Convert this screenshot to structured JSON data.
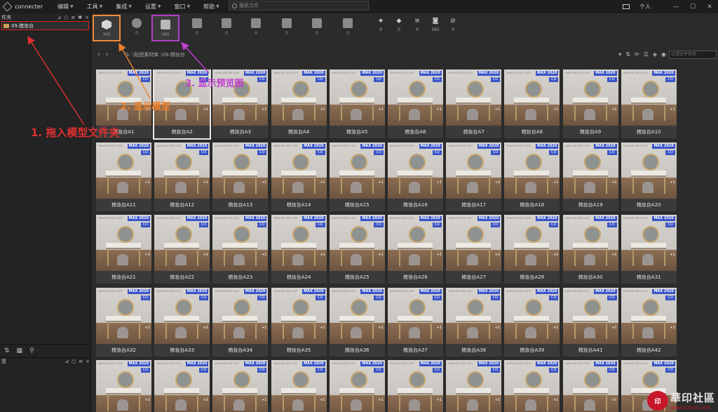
{
  "app": {
    "name": "connecter"
  },
  "menu": [
    {
      "label": "编辑"
    },
    {
      "label": "工具"
    },
    {
      "label": "集成"
    },
    {
      "label": "设置"
    },
    {
      "label": "窗口"
    },
    {
      "label": "帮助"
    }
  ],
  "search": {
    "placeholder": "搜索文件"
  },
  "user": {
    "label": "个人"
  },
  "sidebar": {
    "tree_header": "件夹",
    "tree_item": "09.梳妆台",
    "tag_header": "签"
  },
  "filters": {
    "tiles": [
      {
        "icon": "cube-icon",
        "count": "365"
      },
      {
        "icon": "sphere-icon",
        "count": "0"
      },
      {
        "icon": "image-icon",
        "count": "365"
      },
      {
        "icon": "video-icon",
        "count": "0"
      },
      {
        "icon": "audio-icon",
        "count": "0"
      },
      {
        "icon": "chart-icon",
        "count": "0"
      },
      {
        "icon": "font-icon",
        "count": "0"
      },
      {
        "icon": "code-icon",
        "count": "0"
      },
      {
        "icon": "document-icon",
        "count": "0"
      }
    ],
    "stats": [
      {
        "icon": "star-icon",
        "value": "0"
      },
      {
        "icon": "tag-icon",
        "value": "0"
      },
      {
        "icon": "list-icon",
        "value": "0"
      },
      {
        "icon": "camera-icon",
        "value": "365"
      },
      {
        "icon": "ban-icon",
        "value": "0"
      }
    ]
  },
  "breadcrumb": {
    "drive": "G:",
    "path1": "\\贴图素材库",
    "path2": "\\09.梳妆台"
  },
  "filter_input": {
    "placeholder": "过滤文件名称"
  },
  "card_meta": {
    "max": "MAX 2020",
    "co": "CO",
    "plus": "+1",
    "wm": "www.docaihi.com"
  },
  "items": [
    "梳妆台A1",
    "梳妆台A2",
    "梳妆台A3",
    "梳妆台A4",
    "梳妆台A5",
    "梳妆台A6",
    "梳妆台A7",
    "梳妆台A8",
    "梳妆台A9",
    "梳妆台A10",
    "梳妆台A11",
    "梳妆台A12",
    "梳妆台A13",
    "梳妆台A14",
    "梳妆台A15",
    "梳妆台A16",
    "梳妆台A17",
    "梳妆台A18",
    "梳妆台A19",
    "梳妆台A20",
    "梳妆台A21",
    "梳妆台A22",
    "梳妆台A23",
    "梳妆台A24",
    "梳妆台A25",
    "梳妆台A26",
    "梳妆台A27",
    "梳妆台A28",
    "梳妆台A30",
    "梳妆台A31",
    "梳妆台A32",
    "梳妆台A33",
    "梳妆台A34",
    "梳妆台A35",
    "梳妆台A36",
    "梳妆台A37",
    "梳妆台A38",
    "梳妆台A39",
    "梳妆台A41",
    "梳妆台A42",
    "",
    "",
    "",
    "",
    "",
    "",
    "",
    "",
    "",
    ""
  ],
  "annotations": {
    "step1": "1. 拖入模型文件夹",
    "step2": "2. 显示模型",
    "step3": "3. 显示预览图"
  },
  "watermark": {
    "text": "華印社區",
    "url": "www.52cnp.com"
  },
  "colors": {
    "step1": "#e03030",
    "step2": "#f0802a",
    "step3": "#c040d0",
    "badge": "#3a55c8"
  }
}
